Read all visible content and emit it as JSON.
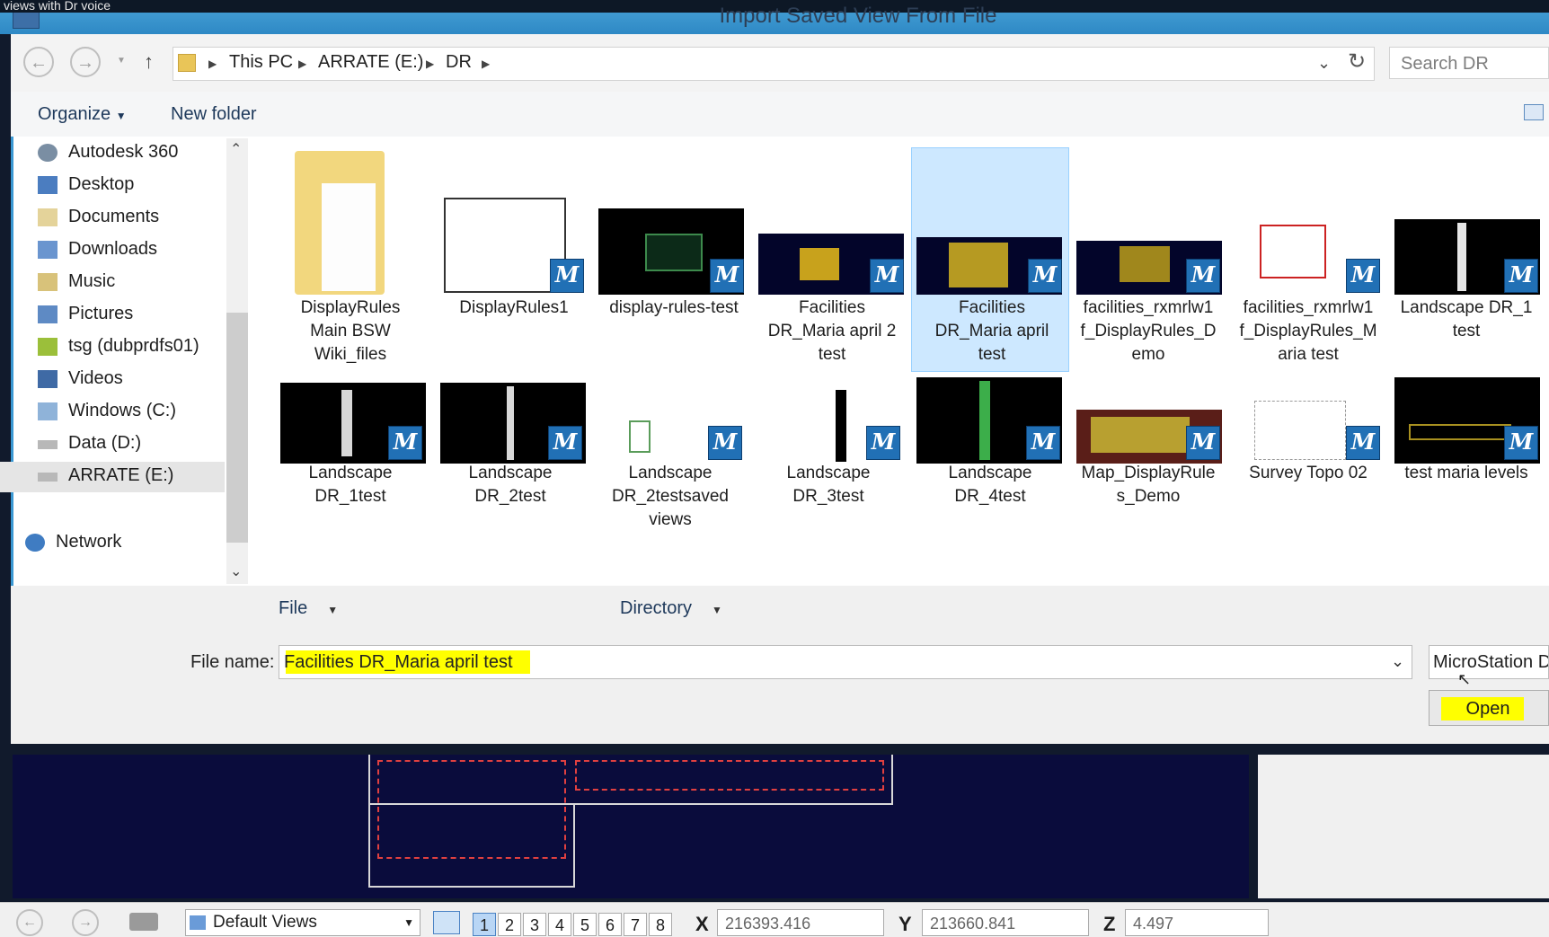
{
  "window": {
    "top_caption": "views with Dr voice",
    "title": "Import Saved View From File"
  },
  "address": {
    "crumbs": [
      "This PC",
      "ARRATE (E:)",
      "DR"
    ],
    "search_placeholder": "Search DR"
  },
  "toolbar": {
    "organize_label": "Organize",
    "new_folder_label": "New folder"
  },
  "nav": {
    "items": [
      {
        "label": "Autodesk 360",
        "icon": "cloud-icon"
      },
      {
        "label": "Desktop",
        "icon": "desktop-icon"
      },
      {
        "label": "Documents",
        "icon": "documents-icon"
      },
      {
        "label": "Downloads",
        "icon": "downloads-icon"
      },
      {
        "label": "Music",
        "icon": "music-icon"
      },
      {
        "label": "Pictures",
        "icon": "pictures-icon"
      },
      {
        "label": "tsg (dubprdfs01)",
        "icon": "network-drive-icon"
      },
      {
        "label": "Videos",
        "icon": "videos-icon"
      },
      {
        "label": "Windows (C:)",
        "icon": "drive-icon"
      },
      {
        "label": "Data (D:)",
        "icon": "drive-icon"
      },
      {
        "label": "ARRATE (E:)",
        "icon": "drive-icon"
      }
    ],
    "network_label": "Network"
  },
  "files": [
    {
      "lines": [
        "DisplayRules",
        "Main  BSW",
        "Wiki_files"
      ]
    },
    {
      "lines": [
        "DisplayRules1"
      ]
    },
    {
      "lines": [
        "display-rules-test"
      ]
    },
    {
      "lines": [
        "Facilities",
        "DR_Maria april 2",
        "test"
      ]
    },
    {
      "lines": [
        "Facilities",
        "DR_Maria april",
        "test"
      ]
    },
    {
      "lines": [
        "facilities_rxmrlw1",
        "f_DisplayRules_D",
        "emo"
      ]
    },
    {
      "lines": [
        "facilities_rxmrlw1",
        "f_DisplayRules_M",
        "aria test"
      ]
    },
    {
      "lines": [
        "Landscape DR_1",
        "test"
      ]
    },
    {
      "lines": [
        "Landscape",
        "DR_1test"
      ]
    },
    {
      "lines": [
        "Landscape",
        "DR_2test"
      ]
    },
    {
      "lines": [
        "Landscape",
        "DR_2testsaved",
        "views"
      ]
    },
    {
      "lines": [
        "Landscape",
        "DR_3test"
      ]
    },
    {
      "lines": [
        "Landscape",
        "DR_4test"
      ]
    },
    {
      "lines": [
        "Map_DisplayRule",
        "s_Demo"
      ]
    },
    {
      "lines": [
        "Survey Topo 02"
      ]
    },
    {
      "lines": [
        "test maria levels"
      ]
    }
  ],
  "bottom": {
    "col_file": "File",
    "col_directory": "Directory",
    "file_name_label": "File name:",
    "file_name_value": "Facilities DR_Maria april test",
    "filter_value": "MicroStation D",
    "open_label": "Open"
  },
  "status": {
    "views_label": "Default Views",
    "pages": [
      "1",
      "2",
      "3",
      "4",
      "5",
      "6",
      "7",
      "8"
    ],
    "x_label": "X",
    "x_value": "216393.416",
    "y_label": "Y",
    "y_value": "213660.841",
    "z_label": "Z",
    "z_value": "4.497"
  }
}
